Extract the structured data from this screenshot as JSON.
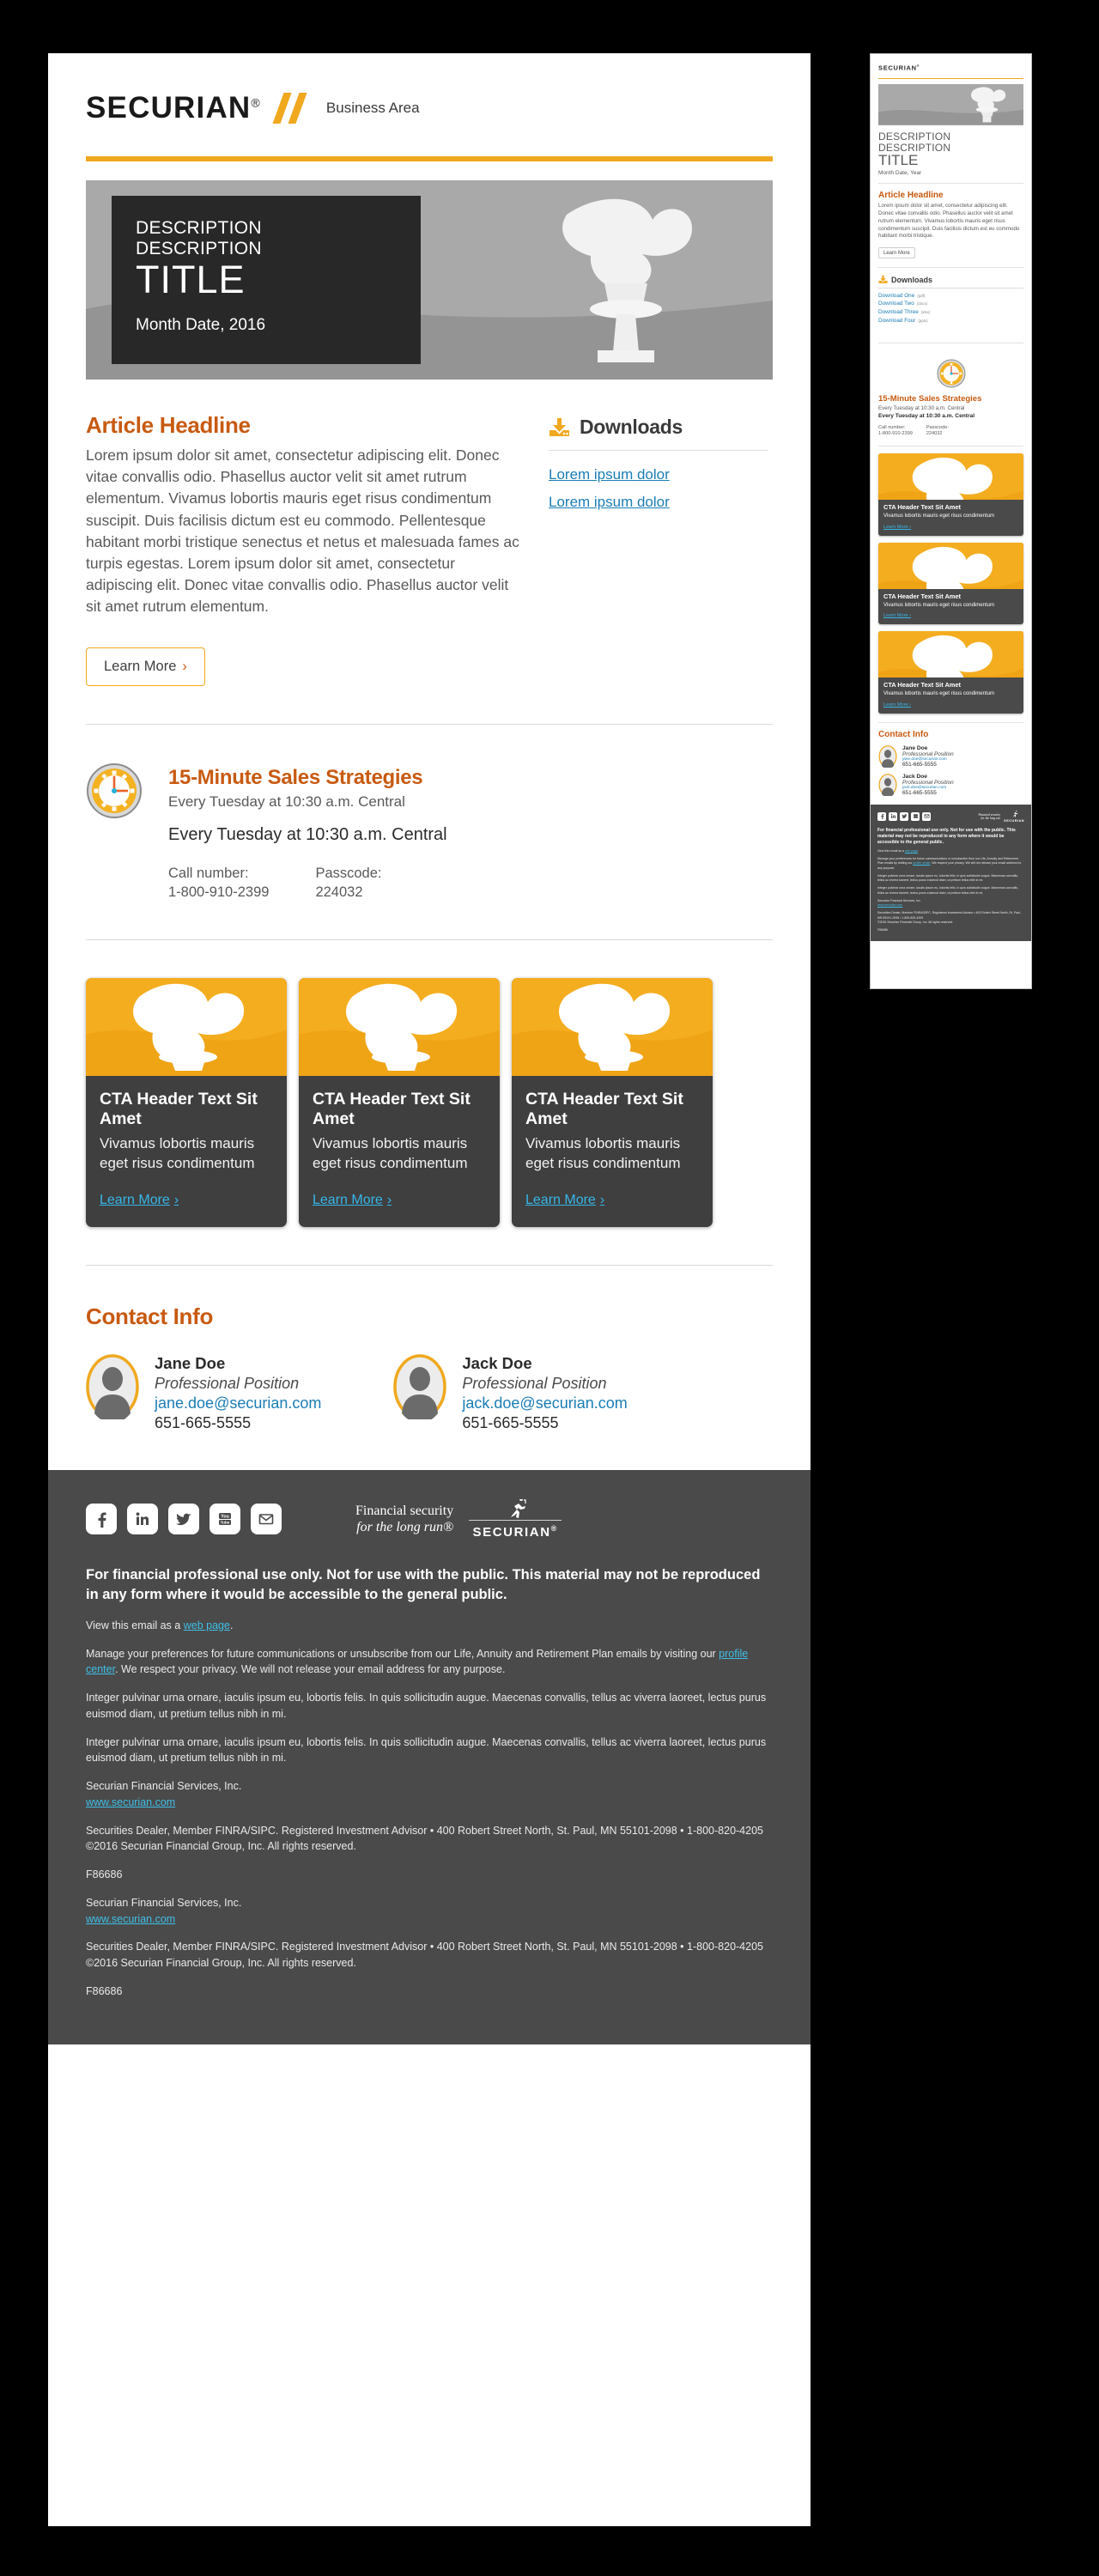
{
  "brand": {
    "logo_word": "SECURIAN",
    "logo_reg": "®",
    "business_area": "Business Area",
    "accent_gold": "#f0a81e",
    "accent_orange": "#c85a11",
    "link_blue": "#1a7db5",
    "cta_link_blue": "#36b6e8",
    "dark_gray": "#4a4a4a"
  },
  "desktop": {
    "hero": {
      "description_line1": "DESCRIPTION",
      "description_line2": "DESCRIPTION",
      "title": "TITLE",
      "date": "Month Date, 2016"
    },
    "article": {
      "headline": "Article Headline",
      "body": "Lorem ipsum dolor sit amet, consectetur adipiscing elit. Donec vitae convallis odio. Phasellus auctor velit sit amet rutrum elementum. Vivamus lobortis mauris eget risus condimentum suscipit. Duis facilisis dictum est eu commodo. Pellentesque habitant morbi tristique senectus et netus et malesuada fames ac turpis egestas. Lorem ipsum dolor sit amet, consectetur adipiscing elit. Donec vitae convallis odio. Phasellus auctor velit sit amet rutrum elementum.",
      "button_label": "Learn More",
      "button_chevron": "›"
    },
    "downloads": {
      "title": "Downloads",
      "links": [
        "Lorem ipsum dolor",
        "Lorem ipsum dolor"
      ]
    },
    "webinar": {
      "title": "15-Minute Sales Strategies",
      "subtitle": "Every Tuesday at 10:30 a.m. Central",
      "strong_line": "Every Tuesday at 10:30 a.m. Central",
      "call_label": "Call number:",
      "call_value": "1-800-910-2399",
      "passcode_label": "Passcode:",
      "passcode_value": "224032"
    },
    "cta_cards": [
      {
        "header": "CTA Header Text Sit Amet",
        "body": "Vivamus lobortis mauris eget risus condimentum",
        "link": "Learn More",
        "chevron": "›"
      },
      {
        "header": "CTA Header Text Sit Amet",
        "body": "Vivamus lobortis mauris eget risus condimentum",
        "link": "Learn More",
        "chevron": "›"
      },
      {
        "header": "CTA Header Text Sit Amet",
        "body": "Vivamus lobortis mauris eget risus condimentum",
        "link": "Learn More",
        "chevron": "›"
      }
    ],
    "contact": {
      "title": "Contact Info",
      "people": [
        {
          "name": "Jane Doe",
          "position": "Professional Position",
          "email": "jane.doe@securian.com",
          "phone": "651-665-5555"
        },
        {
          "name": "Jack Doe",
          "position": "Professional Position",
          "email": "jack.doe@securian.com",
          "phone": "651-665-5555"
        }
      ]
    },
    "footer": {
      "social": [
        "facebook-icon",
        "linkedin-icon",
        "twitter-icon",
        "youtube-icon",
        "email-icon"
      ],
      "tagline_line1": "Financial security",
      "tagline_line2": "for the long run",
      "tagline_mark": "®",
      "tagline_logo": "SECURIAN",
      "tagline_logo_reg": "®",
      "disclaimer": "For financial professional use only. Not for use with the public. This material may not be reproduced in any form where it would be accessible to the general public.",
      "view_email_prefix": "View this email as a ",
      "view_email_link": "web page",
      "view_email_suffix": ".",
      "manage_prefix": "Manage your preferences for future communications or unsubscribe from our Life, Annuity and Retirement Plan emails by visiting our ",
      "manage_link": "profile center",
      "manage_suffix": ". We respect your privacy. We will not release your email address for any purpose.",
      "lorem1": "Integer pulvinar urna ornare, iaculis ipsum eu, lobortis felis. In quis sollicitudin augue. Maecenas convallis, tellus ac viverra laoreet, lectus purus euismod diam, ut pretium tellus nibh in mi.",
      "lorem2": "Integer pulvinar urna ornare, iaculis ipsum eu, lobortis felis. In quis sollicitudin augue. Maecenas convallis, tellus ac viverra laoreet, lectus purus euismod diam, ut pretium tellus nibh in mi.",
      "company": "Securian Financial Services, Inc.",
      "website": "www.securian.com",
      "legal": "Securities Dealer, Member FINRA/SIPC. Registered Investment Advisor • 400 Robert Street North, St. Paul, MN 55101-2098 • 1-800-820-4205",
      "copyright": "©2016 Securian Financial Group, Inc. All rights reserved.",
      "code": "F86686",
      "company2": "Securian Financial Services, Inc.",
      "website2": "www.securian.com",
      "legal2": "Securities Dealer, Member FINRA/SIPC. Registered Investment Advisor • 400 Robert Street North, St. Paul, MN 55101-2098 • 1-800-820-4205",
      "copyright2": "©2016 Securian Financial Group, Inc. All rights reserved.",
      "code2": "F86686"
    }
  },
  "mobile": {
    "logo_word": "SECURIAN",
    "logo_reg": "®",
    "hero": {
      "description_line1": "DESCRIPTION",
      "description_line2": "DESCRIPTION",
      "title": "TITLE",
      "date": "Month Date, Year"
    },
    "article": {
      "headline": "Article Headline",
      "body": "Lorem ipsum dolor sit amet, consectetur adipiscing elit. Donec vitae convallis odio. Phasellus auctor velit sit amet rutrum elementum. Vivamus lobortis mauris eget risus condimentum suscipit. Duis facilisis dictum est eu commodo habitant morbi tristique.",
      "button_label": "Learn More"
    },
    "downloads": {
      "title": "Downloads",
      "links": [
        {
          "label": "Download One",
          "ext": "(pdf)"
        },
        {
          "label": "Download Two",
          "ext": "(docx)"
        },
        {
          "label": "Download Three",
          "ext": "(xlsx)"
        },
        {
          "label": "Download Four",
          "ext": "(pptx)"
        }
      ]
    },
    "webinar": {
      "title": "15-Minute Sales Strategies",
      "subtitle": "Every Tuesday at 10:30 a.m. Central",
      "strong_line": "Every Tuesday at 10:30 a.m. Central",
      "call_label": "Call number:",
      "call_value": "1-800-910-2399",
      "passcode_label": "Passcode:",
      "passcode_value": "224032"
    },
    "cta_cards": [
      {
        "header": "CTA Header Text Sit Amet",
        "body": "Vivamus lobortis mauris eget risus condimentum",
        "link": "Learn More ›"
      },
      {
        "header": "CTA Header Text Sit Amet",
        "body": "Vivamus lobortis mauris eget risus condimentum",
        "link": "Learn More ›"
      },
      {
        "header": "CTA Header Text Sit Amet",
        "body": "Vivamus lobortis mauris eget risus condimentum",
        "link": "Learn More ›"
      }
    ],
    "contact": {
      "title": "Contact Info",
      "people": [
        {
          "name": "Jane Doe",
          "position": "Professional Position",
          "email": "jane.doe@securian.com",
          "phone": "651-665-5555"
        },
        {
          "name": "Jack Doe",
          "position": "Professional Position",
          "email": "jack.doe@securian.com",
          "phone": "651-665-5555"
        }
      ]
    },
    "footer": {
      "tagline_line1": "Financial security",
      "tagline_line2": "for the long run",
      "tagline_logo": "SECURIAN",
      "disclaimer": "For financial professional use only. Not for use with the public. This material may not be reproduced in any form where it would be accessible to the general public.",
      "view_email_prefix": "View this email as a ",
      "view_email_link": "web page",
      "manage_prefix": "Manage your preferences for future communications or unsubscribe from our Life, Annuity and Retirement Plan emails by visiting our ",
      "manage_link": "profile center",
      "manage_suffix": ". We respect your privacy. We will not release your email address for any purpose.",
      "lorem1": "Integer pulvinar urna ornare, iaculis ipsum eu, lobortis felis. In quis sollicitudin augue. Maecenas convallis, tellus ac viverra laoreet, lectus purus euismod diam, ut pretium tellus nibh in mi.",
      "lorem2": "Integer pulvinar urna ornare, iaculis ipsum eu, lobortis felis. In quis sollicitudin augue. Maecenas convallis, tellus ac viverra laoreet, lectus purus euismod diam, ut pretium tellus nibh in mi.",
      "company": "Securian Financial Services, Inc.",
      "website": "www.securian.com",
      "legal": "Securities Dealer, Member FINRA/SIPC. Registered Investment Advisor • 400 Robert Street North, St. Paul, MN 55101-2098 • 1-800-820-4205",
      "copyright": "©2016 Securian Financial Group, Inc. All rights reserved.",
      "code": "F86686"
    }
  }
}
